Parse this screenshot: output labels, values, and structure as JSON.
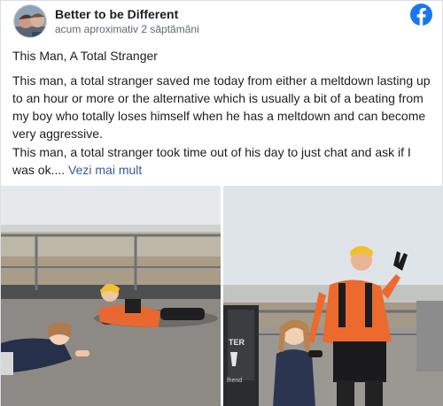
{
  "post": {
    "author": "Better to be Different",
    "timestamp": "acum aproximativ 2 săptămâni",
    "title": "This Man, A Total Stranger",
    "paragraph_1": "This man, a total stranger saved me today from either a meltdown lasting up to an hour or more or the alternative which is usually a bit of a beating from my boy who totally loses himself when he has a meltdown and can become very aggressive.",
    "paragraph_2": "This man, a total stranger took time out of his day to just chat and ask if I was ok....",
    "see_more": "Vezi mai mult"
  },
  "photos": {
    "right": {
      "sign_text": "TER",
      "sign_text_2": "lhend"
    }
  },
  "icons": {
    "logo": "facebook-logo-icon"
  },
  "colors": {
    "brand": "#1877f2",
    "link": "#385898",
    "secondary_text": "#606770"
  }
}
